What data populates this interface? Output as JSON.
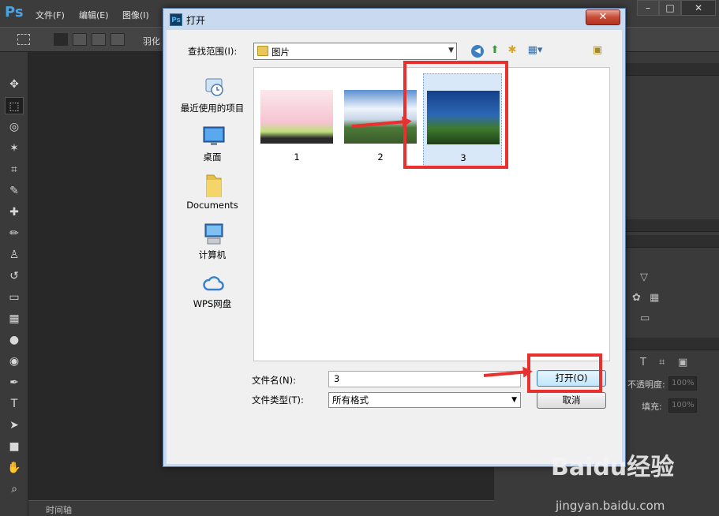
{
  "app": {
    "logo": "Ps",
    "menus": [
      "文件(F)",
      "编辑(E)",
      "图像(I)"
    ],
    "window_controls": [
      "–",
      "□",
      "✕"
    ],
    "options": {
      "feather_label": "羽化"
    }
  },
  "panels": {
    "opacity_label": "不透明度:",
    "opacity_value": "100%",
    "fill_label": "填充:",
    "fill_value": "100%",
    "timeline_label": "时间轴"
  },
  "dialog": {
    "title": "打开",
    "close_icon": "close-icon",
    "lookin_label": "查找范围(I):",
    "lookin_value": "图片",
    "places": [
      {
        "label": "最近使用的项目",
        "icon": "recent-items-icon"
      },
      {
        "label": "桌面",
        "icon": "desktop-icon"
      },
      {
        "label": "Documents",
        "icon": "documents-folder-icon"
      },
      {
        "label": "计算机",
        "icon": "computer-icon"
      },
      {
        "label": "WPS网盘",
        "icon": "wps-cloud-icon"
      }
    ],
    "files": [
      {
        "label": "1",
        "selected": false
      },
      {
        "label": "2",
        "selected": false
      },
      {
        "label": "3",
        "selected": true
      }
    ],
    "filename_label": "文件名(N):",
    "filename_value": "3",
    "filetype_label": "文件类型(T):",
    "filetype_value": "所有格式",
    "open_label": "打开(O)",
    "cancel_label": "取消"
  },
  "annotations": {
    "color": "#e8312f"
  },
  "watermark": {
    "brand": "Baidu经验",
    "url": "jingyan.baidu.com"
  }
}
